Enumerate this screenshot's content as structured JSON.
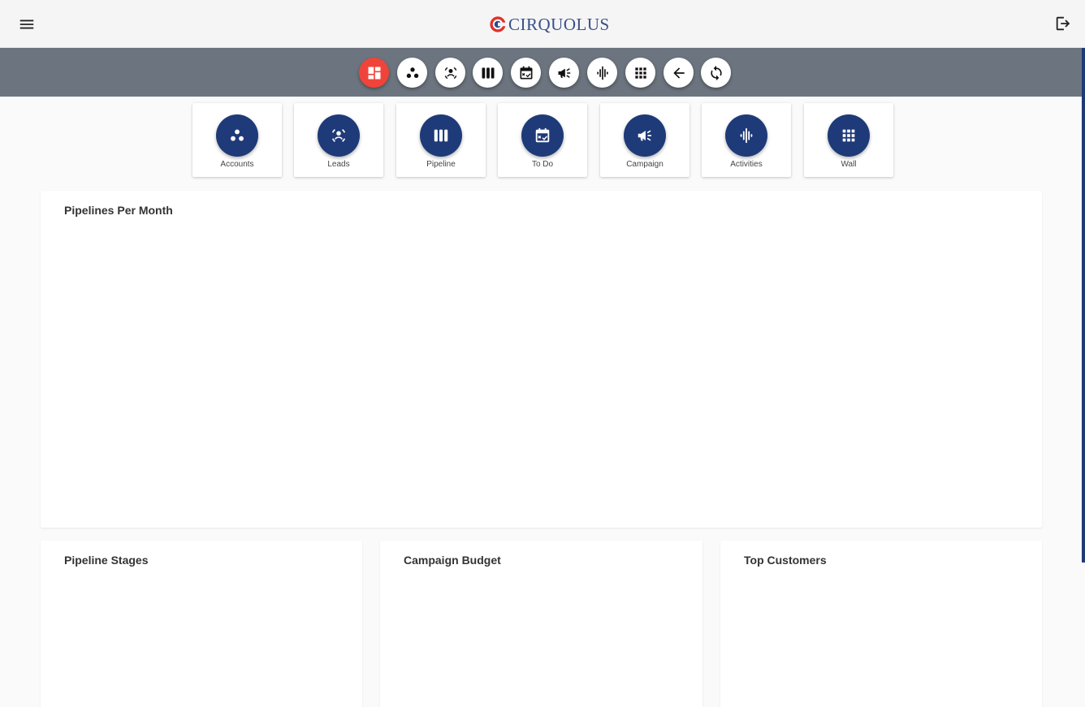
{
  "app": {
    "brand": "CIRQUOLUS"
  },
  "header": {
    "menu_icon": "hamburger-menu-icon",
    "logout_icon": "logout-icon"
  },
  "toolbar": {
    "buttons": [
      {
        "name": "dashboard",
        "icon": "dashboard-icon",
        "active": true
      },
      {
        "name": "accounts",
        "icon": "accounts-icon"
      },
      {
        "name": "leads",
        "icon": "leads-icon"
      },
      {
        "name": "pipeline",
        "icon": "pipeline-icon"
      },
      {
        "name": "todo",
        "icon": "todo-calendar-icon"
      },
      {
        "name": "campaign",
        "icon": "megaphone-icon"
      },
      {
        "name": "activities",
        "icon": "activity-waveform-icon"
      },
      {
        "name": "wall",
        "icon": "grid-icon"
      },
      {
        "name": "back",
        "icon": "arrow-left-icon"
      },
      {
        "name": "refresh",
        "icon": "refresh-icon"
      }
    ]
  },
  "shortcuts": [
    {
      "label": "Accounts",
      "icon": "accounts-icon"
    },
    {
      "label": "Leads",
      "icon": "leads-icon"
    },
    {
      "label": "Pipeline",
      "icon": "pipeline-icon"
    },
    {
      "label": "To Do",
      "icon": "todo-calendar-icon"
    },
    {
      "label": "Campaign",
      "icon": "megaphone-icon"
    },
    {
      "label": "Activities",
      "icon": "activity-waveform-icon"
    },
    {
      "label": "Wall",
      "icon": "grid-icon"
    }
  ],
  "cards": {
    "pipelines_per_month": {
      "title": "Pipelines Per Month"
    },
    "pipeline_stages": {
      "title": "Pipeline Stages"
    },
    "campaign_budget": {
      "title": "Campaign Budget"
    },
    "top_customers": {
      "title": "Top Customers"
    }
  },
  "colors": {
    "primary": "#1e3a78",
    "accent": "#f0443a",
    "toolbar_bg": "#6c757f",
    "appbar_bg": "#f5f5f5"
  }
}
